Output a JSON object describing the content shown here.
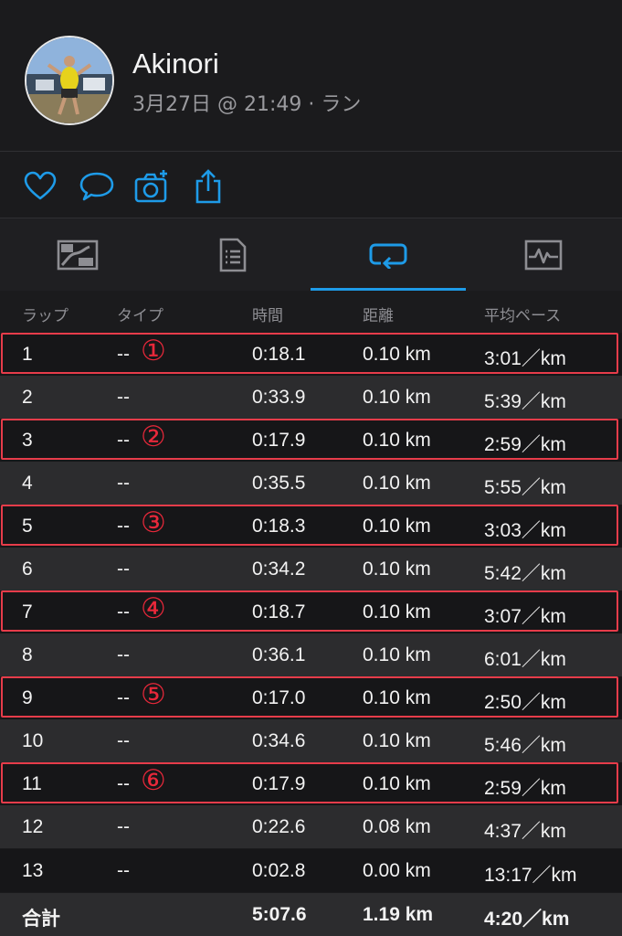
{
  "profile": {
    "name": "Akinori",
    "subtitle": "3月27日 @ 21:49 · ラン"
  },
  "actions": [
    "heart-icon",
    "comment-icon",
    "add-photo-icon",
    "share-icon"
  ],
  "tabs": [
    {
      "icon": "map-icon",
      "active": false
    },
    {
      "icon": "summary-icon",
      "active": false
    },
    {
      "icon": "laps-icon",
      "active": true
    },
    {
      "icon": "graph-icon",
      "active": false
    }
  ],
  "colors": {
    "accent": "#1e9be8",
    "highlight": "#e63c4a",
    "marker": "#e8283a"
  },
  "table": {
    "headers": {
      "lap": "ラップ",
      "type": "タイプ",
      "time": "時間",
      "distance": "距離",
      "pace": "平均ペース"
    },
    "rows": [
      {
        "lap": "1",
        "type": "--",
        "marker": "①",
        "time": "0:18.1",
        "distance": "0.10 km",
        "pace": "3:01／km"
      },
      {
        "lap": "2",
        "type": "--",
        "marker": "",
        "time": "0:33.9",
        "distance": "0.10 km",
        "pace": "5:39／km"
      },
      {
        "lap": "3",
        "type": "--",
        "marker": "②",
        "time": "0:17.9",
        "distance": "0.10 km",
        "pace": "2:59／km"
      },
      {
        "lap": "4",
        "type": "--",
        "marker": "",
        "time": "0:35.5",
        "distance": "0.10 km",
        "pace": "5:55／km"
      },
      {
        "lap": "5",
        "type": "--",
        "marker": "③",
        "time": "0:18.3",
        "distance": "0.10 km",
        "pace": "3:03／km"
      },
      {
        "lap": "6",
        "type": "--",
        "marker": "",
        "time": "0:34.2",
        "distance": "0.10 km",
        "pace": "5:42／km"
      },
      {
        "lap": "7",
        "type": "--",
        "marker": "④",
        "time": "0:18.7",
        "distance": "0.10 km",
        "pace": "3:07／km"
      },
      {
        "lap": "8",
        "type": "--",
        "marker": "",
        "time": "0:36.1",
        "distance": "0.10 km",
        "pace": "6:01／km"
      },
      {
        "lap": "9",
        "type": "--",
        "marker": "⑤",
        "time": "0:17.0",
        "distance": "0.10 km",
        "pace": "2:50／km"
      },
      {
        "lap": "10",
        "type": "--",
        "marker": "",
        "time": "0:34.6",
        "distance": "0.10 km",
        "pace": "5:46／km"
      },
      {
        "lap": "11",
        "type": "--",
        "marker": "⑥",
        "time": "0:17.9",
        "distance": "0.10 km",
        "pace": "2:59／km"
      },
      {
        "lap": "12",
        "type": "--",
        "marker": "",
        "time": "0:22.6",
        "distance": "0.08 km",
        "pace": "4:37／km"
      },
      {
        "lap": "13",
        "type": "--",
        "marker": "",
        "time": "0:02.8",
        "distance": "0.00 km",
        "pace": "13:17／km"
      }
    ],
    "total": {
      "label": "合計",
      "time": "5:07.6",
      "distance": "1.19 km",
      "pace": "4:20／km"
    }
  }
}
